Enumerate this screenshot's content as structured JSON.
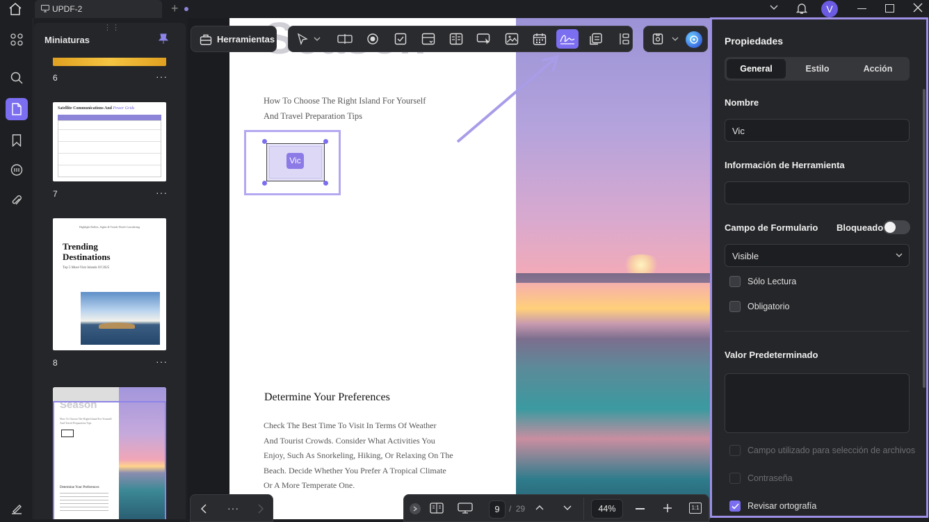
{
  "titlebar": {
    "tab_title": "UPDF-2",
    "new_tab": "+",
    "avatar_letter": "V"
  },
  "thumbnails": {
    "title": "Miniaturas",
    "pages": [
      "6",
      "7",
      "8"
    ],
    "more": "···",
    "t7_title": "Satellite Communications And",
    "t7_title_em": "Power Grids",
    "t8_header": "Highlight Bullets, Sights & Trends Worth Considering",
    "t8_title1": "Trending",
    "t8_title2": "Destinations",
    "t8_sub": "Top 5 Must-Visit Islands Of 2025",
    "t9_title": "Season",
    "t9_line1": "How To Choose The Right Island For Yourself",
    "t9_line2": "And Travel Preparation Tips",
    "t9_heading": "Determine Your Preferences"
  },
  "toolbar": {
    "tools_label": "Herramientas"
  },
  "document": {
    "title_fragment": "Season",
    "subtitle1": "How To Choose The Right Island For Yourself",
    "subtitle2": "And Travel Preparation Tips",
    "field_label": "Vic",
    "heading": "Determine Your Preferences",
    "para": [
      "Check The Best Time To Visit In Terms Of Weather",
      "And Tourist Crowds. Consider What Activities You",
      "Enjoy, Such As Snorkeling, Hiking, Or Relaxing On The",
      "Beach. Decide Whether You Prefer A Tropical Climate",
      "Or A More Temperate One."
    ]
  },
  "bottom": {
    "page_current": "9",
    "page_sep": "/",
    "page_total": "29",
    "zoom": "44%",
    "more": "···",
    "fit_label": "1:1"
  },
  "properties": {
    "title": "Propiedades",
    "tabs": [
      "General",
      "Estilo",
      "Acción"
    ],
    "name_label": "Nombre",
    "name_value": "Vic",
    "tooltip_label": "Información de Herramienta",
    "tooltip_value": "",
    "form_field_label": "Campo de Formulario",
    "locked_label": "Bloqueado",
    "visibility_value": "Visible",
    "readonly_label": "Sólo Lectura",
    "required_label": "Obligatorio",
    "default_label": "Valor Predeterminado",
    "default_value": "",
    "file_select_label": "Campo utilizado para selección de archivos",
    "password_label": "Contraseña",
    "spellcheck_label": "Revisar ortografía"
  },
  "colors": {
    "accent": "#7b6ef0",
    "selection": "#b3a8f0",
    "panel_border": "#9d8fe6"
  }
}
